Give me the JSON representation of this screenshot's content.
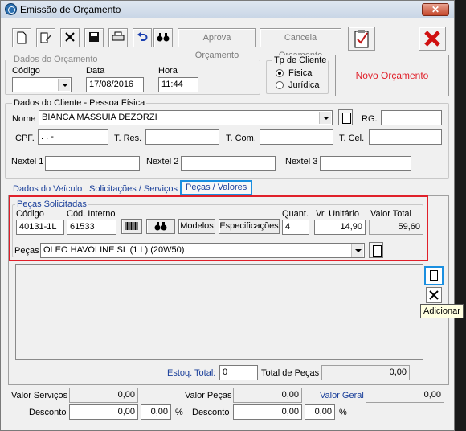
{
  "window": {
    "title": "Emissão de Orçamento",
    "close": "✕"
  },
  "toolbar": {
    "aprova_label": "Aprova Orçamento",
    "cancela_label": "Cancela Orçamento"
  },
  "dados_orcamento": {
    "legend": "Dados do Orçamento",
    "codigo_label": "Código",
    "codigo_value": "",
    "data_label": "Data",
    "data_value": "17/08/2016",
    "hora_label": "Hora",
    "hora_value": "11:44"
  },
  "tp_cliente": {
    "legend": "Tp de Cliente",
    "options": [
      "Física",
      "Jurídica"
    ],
    "selected": "Física"
  },
  "novo_orcamento_label": "Novo Orçamento",
  "cliente": {
    "legend": "Dados do Cliente  -  Pessoa Física",
    "nome_label": "Nome",
    "nome_value": "BIANCA MASSUIA DEZORZI",
    "rg_label": "RG.",
    "rg_value": "",
    "cpf_label": "CPF.",
    "cpf_value": "  .   .   -",
    "tres_label": "T. Res.",
    "tres_value": "",
    "tcom_label": "T. Com.",
    "tcom_value": "",
    "tcel_label": "T. Cel.",
    "tcel_value": "",
    "nextel1_label": "Nextel 1",
    "nextel2_label": "Nextel 2",
    "nextel3_label": "Nextel 3"
  },
  "tabs": {
    "veiculo": "Dados do Veículo",
    "solicitacoes": "Solicitações / Serviços",
    "pecas": "Peças / Valores"
  },
  "pecas_solicitadas": {
    "legend": "Peças Solicitadas",
    "codigo_label": "Código",
    "codigo_value": "40131-1L",
    "cod_interno_label": "Cód. Interno",
    "cod_interno_value": "61533",
    "modelos_label": "Modelos",
    "especificacoes_label": "Especificações",
    "quant_label": "Quant.",
    "quant_value": "4",
    "vr_unitario_label": "Vr. Unitário",
    "vr_unitario_value": "14,90",
    "valor_total_label": "Valor Total",
    "valor_total_value": "59,60",
    "pecas_label": "Peças",
    "pecas_value": "OLEO HAVOLINE SL (1 L) (20W50)"
  },
  "tooltip": {
    "adicionar": "Adicionar"
  },
  "estoque": {
    "estoq_label": "Estoq. Total:",
    "estoq_value": "0",
    "total_pecas_label": "Total de Peças",
    "total_pecas_value": "0,00"
  },
  "totais": {
    "valor_servicos_label": "Valor Serviços",
    "valor_servicos_value": "0,00",
    "valor_pecas_label": "Valor Peças",
    "valor_pecas_value": "0,00",
    "valor_geral_label": "Valor Geral",
    "valor_geral_value": "0,00",
    "desconto_label": "Desconto",
    "desc_serv_value": "0,00",
    "desc_serv_pct": "0,00",
    "desc_pecas_value": "0,00",
    "desc_pecas_pct": "0,00",
    "pct": "%"
  },
  "colors": {
    "highlight_red": "#e0202a",
    "tab_blue": "#1a8fe0",
    "link_blue": "#1a3f9a"
  }
}
